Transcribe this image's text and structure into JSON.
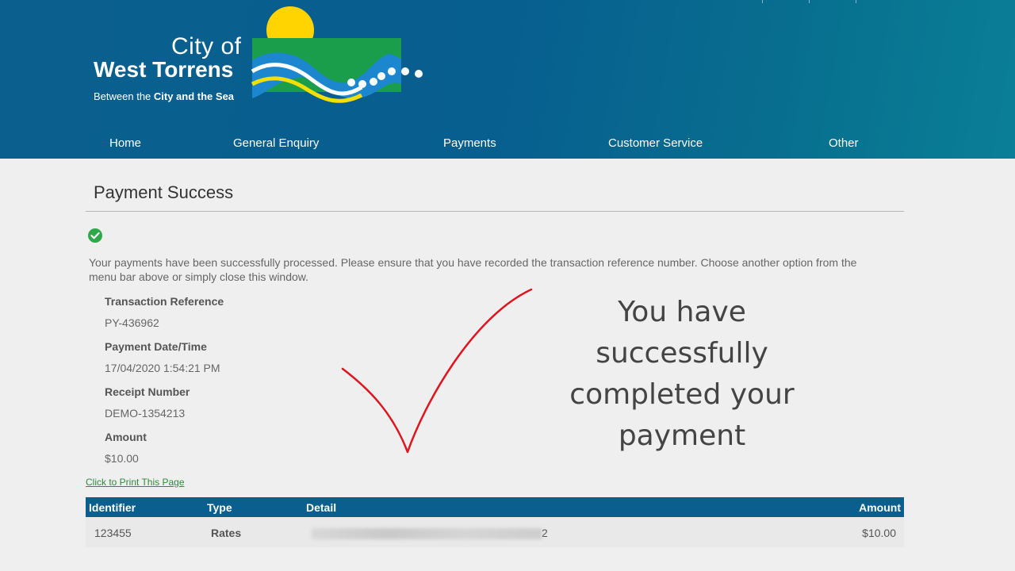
{
  "header": {
    "logo": {
      "city_of": "City of",
      "west_torrens": "West Torrens",
      "tagline_prefix": "Between the ",
      "tagline_bold": "City and the Sea"
    },
    "nav": [
      {
        "label": "Home"
      },
      {
        "label": "General Enquiry"
      },
      {
        "label": "Payments"
      },
      {
        "label": "Customer Service"
      },
      {
        "label": "Other"
      }
    ]
  },
  "main": {
    "title": "Payment Success",
    "message": "Your payments have been successfully processed. Please ensure that you have recorded the transaction reference number. Choose another option from the menu bar above or simply close this window.",
    "fields": [
      {
        "label": "Transaction Reference",
        "value": "PY-436962"
      },
      {
        "label": "Payment Date/Time",
        "value": "17/04/2020 1:54:21 PM"
      },
      {
        "label": "Receipt Number",
        "value": "DEMO-1354213"
      },
      {
        "label": "Amount",
        "value": "$10.00"
      }
    ],
    "print_link": "Click to Print This Page",
    "table": {
      "headers": {
        "identifier": "Identifier",
        "type": "Type",
        "detail": "Detail",
        "amount": "Amount"
      },
      "rows": [
        {
          "identifier": "123455",
          "type": "Rates",
          "detail_suffix": "2",
          "amount": "$10.00"
        }
      ]
    }
  },
  "overlay": {
    "lines": [
      "You have",
      "successfully",
      "completed your",
      "payment"
    ]
  },
  "colors": {
    "header_blue": "#0a5f8e",
    "success_green": "#2ea84a",
    "link_green": "#2e8b3a",
    "annotation_red": "#e0141e"
  }
}
